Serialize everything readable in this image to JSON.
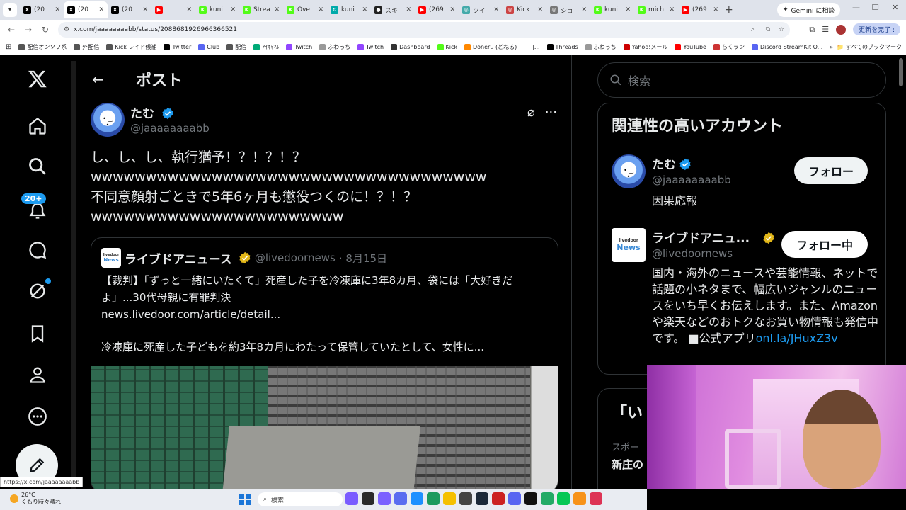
{
  "browser": {
    "tabs": [
      {
        "label": "(20",
        "fav": "X",
        "color": "#000"
      },
      {
        "label": "(20",
        "fav": "X",
        "color": "#000",
        "active": true
      },
      {
        "label": "(20",
        "fav": "X",
        "color": "#000"
      },
      {
        "label": "",
        "fav": "▶",
        "color": "#ff0000"
      },
      {
        "label": "kuni",
        "fav": "K",
        "color": "#53fc18"
      },
      {
        "label": "Strea",
        "fav": "K",
        "color": "#53fc18"
      },
      {
        "label": "Ove",
        "fav": "K",
        "color": "#53fc18"
      },
      {
        "label": "kuni",
        "fav": "↻",
        "color": "#0aa"
      },
      {
        "label": "スキ",
        "fav": "●",
        "color": "#222"
      },
      {
        "label": "(269",
        "fav": "▶",
        "color": "#ff0000"
      },
      {
        "label": "ツイ",
        "fav": "◎",
        "color": "#4aa"
      },
      {
        "label": "Kick",
        "fav": "◎",
        "color": "#c44"
      },
      {
        "label": "ショ",
        "fav": "◎",
        "color": "#777"
      },
      {
        "label": "kuni",
        "fav": "K",
        "color": "#53fc18"
      },
      {
        "label": "mich",
        "fav": "K",
        "color": "#53fc18"
      },
      {
        "label": "(269",
        "fav": "▶",
        "color": "#ff0000"
      }
    ],
    "gemini_label": "Gemini に相談",
    "url": "x.com/jaaaaaaaabb/status/2088681926966366521",
    "update_label": "更新を完了 :",
    "bookmarks": [
      {
        "label": "配信オンソフ系",
        "color": "#555"
      },
      {
        "label": "外配信",
        "color": "#555"
      },
      {
        "label": "Kick レイド候補",
        "color": "#555"
      },
      {
        "label": "Twitter",
        "color": "#000"
      },
      {
        "label": "Club",
        "color": "#5865f2"
      },
      {
        "label": "配信",
        "color": "#555"
      },
      {
        "label": "ｱｲｷｬﾏﾙ",
        "color": "#0a7"
      },
      {
        "label": "Twitch",
        "color": "#9146ff"
      },
      {
        "label": "ふわっち",
        "color": "#999"
      },
      {
        "label": "Twitch",
        "color": "#9146ff"
      },
      {
        "label": "Dashboard",
        "color": "#333"
      },
      {
        "label": "Kick",
        "color": "#53fc18"
      },
      {
        "label": "Doneru (どねる)",
        "color": "#f80"
      },
      {
        "label": "|...",
        "color": "#fff"
      },
      {
        "label": "Threads",
        "color": "#000"
      },
      {
        "label": "ふわっち",
        "color": "#999"
      },
      {
        "label": "Yahoo!メール",
        "color": "#c00"
      },
      {
        "label": "YouTube",
        "color": "#f00"
      },
      {
        "label": "らくラン",
        "color": "#c33"
      },
      {
        "label": "Discord StreamKit O...",
        "color": "#5865f2"
      }
    ],
    "all_bookmarks": "すべてのブックマーク"
  },
  "nav": {
    "notif_badge": "20+"
  },
  "post": {
    "header_title": "ポスト",
    "author_name": "たむ",
    "author_handle": "@jaaaaaaaabb",
    "lines": [
      "し、し、し、執行猶予！？！？！？",
      "wwwwwwwwwwwwwwwwwwwwwwwwwwwwwwwwwwww",
      "不同意顔射ごときで5年6ヶ月も懲役つくのに！？！？",
      "wwwwwwwwwwwwwwwwwwwwwww"
    ]
  },
  "quote": {
    "logo_top": "livedoor",
    "logo_bottom": "News",
    "name": "ライブドアニュース",
    "handle": "@livedoornews",
    "date": "· 8月15日",
    "body": "【裁判】「ずっと一緒にいたくて」死産した子を冷凍庫に3年8カ月、袋には「大好きだよ」...30代母親に有罪判決",
    "link": "news.livedoor.com/article/detail...",
    "summary": "冷凍庫に死産した子どもを約3年8カ月にわたって保管していたとして、女性に..."
  },
  "sidebar": {
    "search_placeholder": "検索",
    "related_title": "関連性の高いアカウント",
    "accounts": [
      {
        "name": "たむ",
        "handle": "@jaaaaaaaabb",
        "button": "フォロー",
        "bio": "因果応報"
      },
      {
        "name": "ライブドアニュ...",
        "handle": "@livedoornews",
        "button": "フォロー中",
        "bio": "国内・海外のニュースや芸能情報、ネットで話題の小ネタまで、幅広いジャンルのニュースをいち早くお伝えします。また、Amazonや楽天などのおトクなお買い物情報も発信中です。 ■公式アプリ",
        "bio_link": "onl.la/JHuxZ3v"
      }
    ],
    "trend_title": "「い",
    "trend_sub": "スポー",
    "trend_name": "新庄の"
  },
  "statusbar_url": "https://x.com/jaaaaaaaabb",
  "taskbar": {
    "temp": "26°C",
    "weather": "くもり時々晴れ",
    "search": "検索",
    "icons": [
      "#7a5cff",
      "#2a2a2a",
      "#7b61ff",
      "#5a6cf0",
      "#1e90ff",
      "#1c9a5e",
      "#f5c000",
      "#444",
      "#1b2838",
      "#c22",
      "#5865f2",
      "#111",
      "#2a6",
      "#06c755",
      "#f7931a",
      "#d35"
    ]
  }
}
